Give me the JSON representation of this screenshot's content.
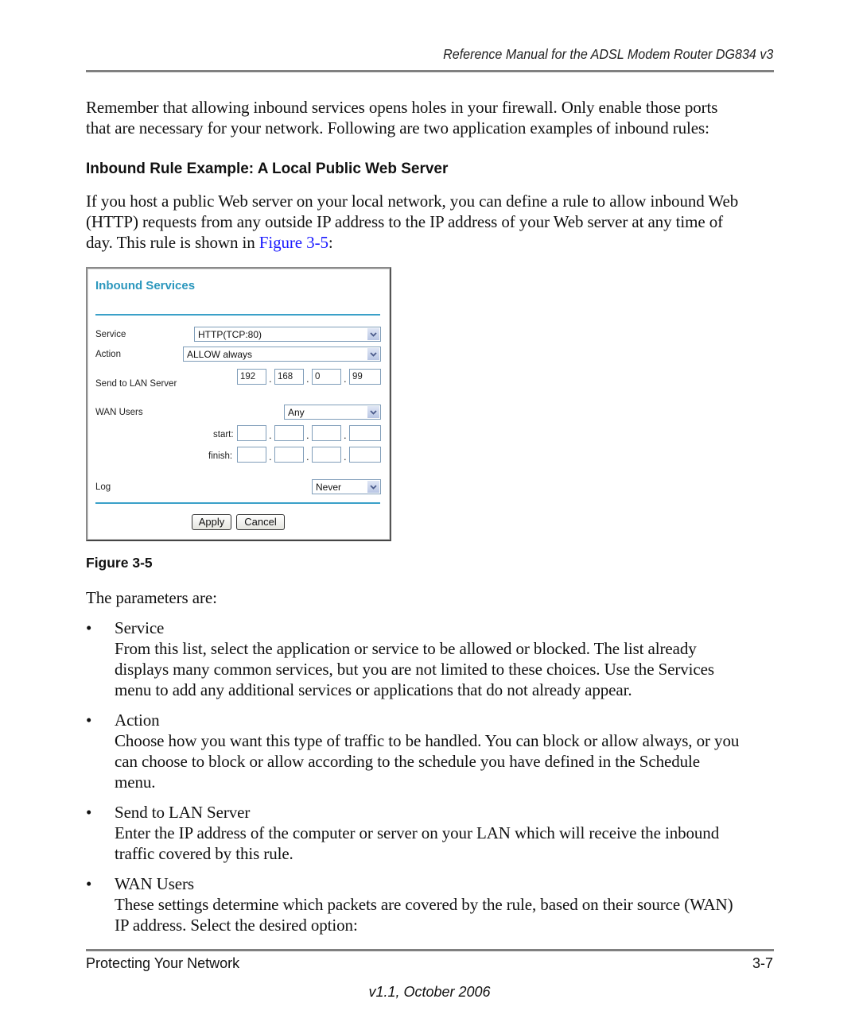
{
  "header": {
    "title": "Reference Manual for the ADSL Modem Router DG834 v3"
  },
  "intro": {
    "line1": "Remember that allowing inbound services opens holes in your firewall. Only enable those ports",
    "line2": "that are necessary for your network. Following are two application examples of inbound rules:"
  },
  "section": {
    "heading": "Inbound Rule Example: A Local Public Web Server",
    "line1": "If you host a public Web server on your local network, you can define a rule to allow inbound Web",
    "line2": "(HTTP) requests from any outside IP address to the IP address of your Web server at any time of",
    "line3_prefix": "day. This rule is shown in ",
    "line3_link": "Figure 3-5",
    "line3_suffix": ":"
  },
  "figure": {
    "title": "Inbound Services",
    "service_label": "Service",
    "service_value": "HTTP(TCP:80)",
    "action_label": "Action",
    "action_value": "ALLOW always",
    "lan_label": "Send to LAN Server",
    "lan_ip": [
      "192",
      "168",
      "0",
      "99"
    ],
    "wan_label": "WAN Users",
    "wan_value": "Any",
    "start_label": "start:",
    "finish_label": "finish:",
    "start_ip": [
      "",
      "",
      "",
      ""
    ],
    "finish_ip": [
      "",
      "",
      "",
      ""
    ],
    "log_label": "Log",
    "log_value": "Never",
    "apply_label": "Apply",
    "cancel_label": "Cancel",
    "dot": ".",
    "caption": "Figure 3-5"
  },
  "params": {
    "intro": "The parameters are:",
    "bullet": "•",
    "items": [
      {
        "title": "Service",
        "lines": [
          "From this list, select the application or service to be allowed or blocked. The list already",
          "displays many common services, but you are not limited to these choices. Use the Services",
          "menu to add any additional services or applications that do not already appear."
        ]
      },
      {
        "title": "Action",
        "lines": [
          "Choose how you want this type of traffic to be handled. You can block or allow always, or you",
          "can choose to block or allow according to the schedule you have defined in the Schedule",
          "menu."
        ]
      },
      {
        "title": "Send to LAN Server",
        "lines": [
          "Enter the IP address of the computer or server on your LAN which will receive the inbound",
          "traffic covered by this rule."
        ]
      },
      {
        "title": "WAN Users",
        "lines": [
          "These settings determine which packets are covered by the rule, based on their source (WAN)",
          "IP address. Select the desired option:"
        ]
      }
    ]
  },
  "footer": {
    "section": "Protecting Your Network",
    "page": "3-7",
    "version": "v1.1, October 2006"
  }
}
